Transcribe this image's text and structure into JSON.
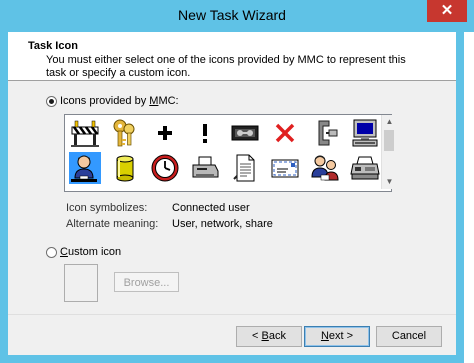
{
  "window": {
    "title": "New Task Wizard",
    "close_glyph": "✕"
  },
  "header": {
    "title": "Task Icon",
    "description": "You must either select one of the icons provided by MMC to represent this task or specify a custom icon."
  },
  "options": {
    "mmc_icons": {
      "label_pre": "Icons provided by ",
      "label_accel": "M",
      "label_post": "MC:",
      "selected": true
    },
    "custom_icon": {
      "label_accel": "C",
      "label_post": "ustom icon",
      "selected": false
    }
  },
  "icons": [
    {
      "name": "roadblock-icon"
    },
    {
      "name": "keys-icon"
    },
    {
      "name": "plus-icon"
    },
    {
      "name": "exclamation-icon"
    },
    {
      "name": "tape-drive-icon"
    },
    {
      "name": "red-x-icon"
    },
    {
      "name": "clamp-icon"
    },
    {
      "name": "computer-icon"
    },
    {
      "name": "connected-user-icon",
      "selected": true
    },
    {
      "name": "database-cylinder-icon"
    },
    {
      "name": "clock-icon"
    },
    {
      "name": "printer-icon"
    },
    {
      "name": "document-icon"
    },
    {
      "name": "envelope-icon"
    },
    {
      "name": "user-group-icon"
    },
    {
      "name": "fax-icon"
    }
  ],
  "icon_info": {
    "symbolizes_label": "Icon symbolizes:",
    "symbolizes_value": "Connected user",
    "alternate_label": "Alternate meaning:",
    "alternate_value": "User, network, share"
  },
  "browse_label": "Browse...",
  "buttons": {
    "back_prefix": "< ",
    "back_accel": "B",
    "back_rest": "ack",
    "next_accel": "N",
    "next_rest": "ext >",
    "cancel": "Cancel"
  },
  "colors": {
    "accent_frame": "#5fc2e6",
    "close": "#c7372f",
    "selection": "#3399ff"
  }
}
